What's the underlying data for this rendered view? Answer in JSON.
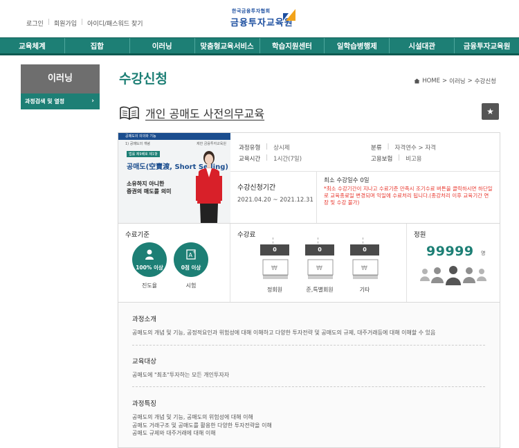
{
  "header": {
    "links": [
      "로그인",
      "회원가입",
      "아이디/패스워드 찾기"
    ],
    "logo_top": "한국금융투자협회",
    "logo_main": "금융투자교육원"
  },
  "gnb": [
    "교육체계",
    "집합",
    "이러닝",
    "맞춤형교육서비스",
    "학습지원센터",
    "일학습병행제",
    "시설대관",
    "금융투자교육원"
  ],
  "sidebar": {
    "title": "이러닝",
    "sub": "과정검색 및 열정",
    "chevron": "›"
  },
  "page": {
    "title": "수강신청",
    "breadcrumb": [
      "HOME",
      "이러닝",
      "수강신청"
    ],
    "breadcrumb_sep": ">"
  },
  "course": {
    "title": "개인 공매도 사전의무교육",
    "star": "★",
    "thumb": {
      "bar_text": "공매도의 의의와 기능",
      "sub_text": "1) 공매도의 개념",
      "label": "법률 제9배호 제1항",
      "big1": "공매도(空賣渡, Short Selling)",
      "big2a": "소유하지 아니한",
      "big2b": "증권의 매도를 의미",
      "brand": "제한 금융투자교육원"
    },
    "type_key": "과정유형",
    "type_val": "상시제",
    "time_key": "교육시간",
    "time_val": "1시간(7일)",
    "cat_key": "분류",
    "cat_val": "자격연수 > 자격",
    "ins_key": "고용보험",
    "ins_val": "비고용",
    "period_head": "수강신청기간",
    "period_val": "2021.04.20 ~ 2021.12.31",
    "min_head": "최소 수강일수  0일",
    "min_note": "*최소 수강기간이 지나고 수료기준 만족시 조기수료 버튼을 클릭하시면 하단일로 교육종료일 변경되며 익일에 수료처리 됩니다.(종강처리 이후 교육기간 연장 및 수강 불가)",
    "criteria_head": "수료기준",
    "criteria": [
      {
        "value": "100% 이상",
        "label": "진도율",
        "icon": "person-icon"
      },
      {
        "value": "0점 이상",
        "label": "시험",
        "icon": "exam-icon"
      }
    ],
    "fee_head": "수강료",
    "fees": [
      {
        "amount": "0",
        "label": "정회원"
      },
      {
        "amount": "0",
        "label": "준,특별회원"
      },
      {
        "amount": "0",
        "label": "기타"
      }
    ],
    "capacity_head": "정원",
    "capacity": "99999",
    "capacity_unit": "명"
  },
  "details": {
    "intro_head": "과정소개",
    "intro": "공매도의 개념 및 기능, 공정적요인과 위험성에 대해 이해하고 다양한 투자전략 및 공매도의 규제, 대주거래등에 대해 이해할 수 있음",
    "target_head": "교육대상",
    "target": "공매도에 \"최초\"투자하는 모든 개인투자자",
    "feature_head": "과정특징",
    "features": [
      "공매도의 개념 및 기능, 공매도의 위험성에 대해 이해",
      "공매도 거래구조 및 공매도를 활용한 다양한 투자전략을 이해",
      "공매도 규제와 대주거래에 대해 이해"
    ]
  },
  "colors": {
    "primary": "#1d7f75",
    "sidebar_gray": "#6e6e6e",
    "notice_red": "#e8372e",
    "logo_blue": "#1d4fa0"
  }
}
